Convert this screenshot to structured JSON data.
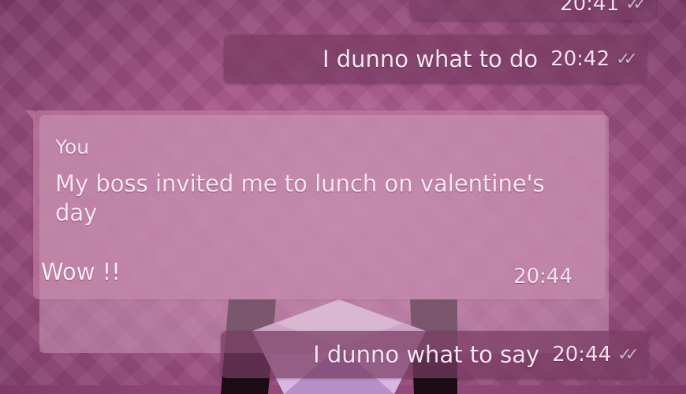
{
  "messages": [
    {
      "direction": "outgoing",
      "time": "20:41",
      "status": "read"
    },
    {
      "direction": "outgoing",
      "text": "I dunno what to do",
      "time": "20:42",
      "status": "read"
    },
    {
      "direction": "incoming",
      "quoted": {
        "author": "You",
        "text": "My boss invited me to lunch on valentine's day"
      },
      "text": "Wow !!",
      "time": "20:44"
    },
    {
      "direction": "outgoing",
      "text": "I dunno what to say",
      "time": "20:44",
      "status": "read"
    }
  ],
  "icons": {
    "read_receipt": "double-check-icon",
    "emoji": "emoji-face-icon"
  }
}
